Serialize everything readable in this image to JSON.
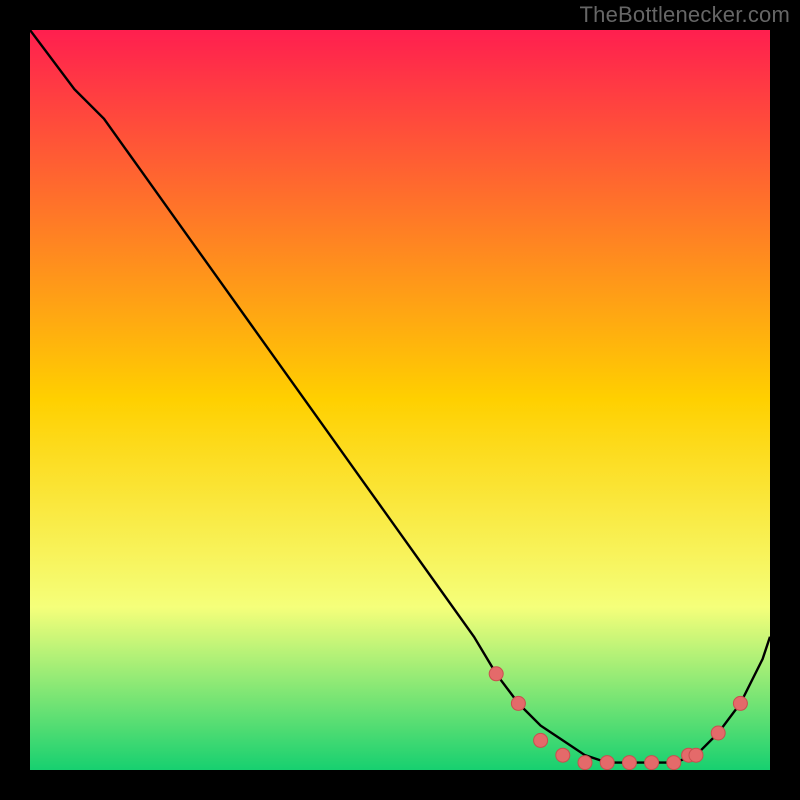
{
  "attribution": "TheBottlenecker.com",
  "colors": {
    "gradient_top": "#ff1f4f",
    "gradient_mid": "#ffd000",
    "gradient_low": "#f5ff7a",
    "gradient_bottom": "#17d070",
    "curve": "#000000",
    "dot_fill": "#e46a6a",
    "dot_stroke": "#c94f4f",
    "frame": "#000000"
  },
  "chart_data": {
    "type": "line",
    "title": "",
    "xlabel": "",
    "ylabel": "",
    "xlim": [
      0,
      100
    ],
    "ylim": [
      0,
      100
    ],
    "description": "Single curve descending from top-left to a flat minimum near the right, then rising toward the right edge. Values are estimated from pixel positions (no axis labels present).",
    "x": [
      0,
      6,
      10,
      15,
      20,
      25,
      30,
      35,
      40,
      45,
      50,
      55,
      60,
      63,
      66,
      69,
      72,
      75,
      78,
      81,
      84,
      87,
      90,
      93,
      96,
      99,
      100
    ],
    "values": [
      100,
      92,
      88,
      81,
      74,
      67,
      60,
      53,
      46,
      39,
      32,
      25,
      18,
      13,
      9,
      6,
      4,
      2,
      1,
      1,
      1,
      1,
      2,
      5,
      9,
      15,
      18
    ],
    "markers_x": [
      63,
      66,
      69,
      72,
      75,
      78,
      81,
      84,
      87,
      89,
      90,
      93,
      96
    ],
    "markers_y": [
      13,
      9,
      4,
      2,
      1,
      1,
      1,
      1,
      1,
      2,
      2,
      5,
      9
    ]
  }
}
